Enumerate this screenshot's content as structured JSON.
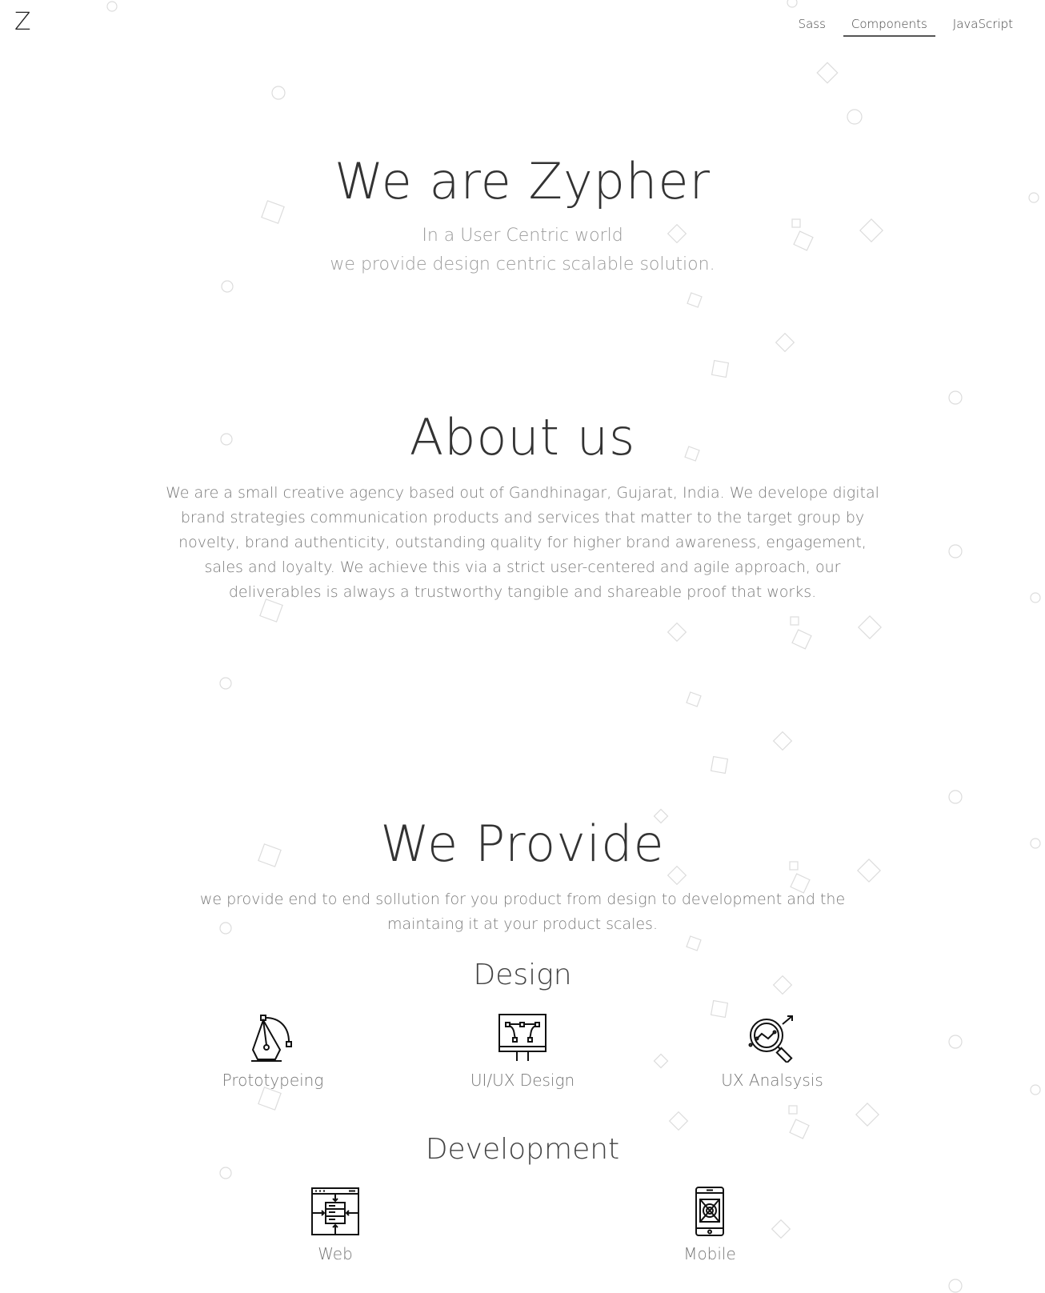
{
  "brand": {
    "logo": "Z"
  },
  "nav": {
    "items": [
      {
        "label": "Sass"
      },
      {
        "label": "Components",
        "active": true
      },
      {
        "label": "JavaScript"
      }
    ]
  },
  "hero": {
    "title": "We are Zypher",
    "subtitle_line1": "In a User Centric world",
    "subtitle_line2": "we provide design centric scalable solution."
  },
  "about": {
    "title": "About us",
    "text": "We are a small creative agency based out of Gandhinagar, Gujarat, India. We develope digital brand strategies communication products and services that matter to the target group by novelty, brand authenticity, outstanding quality for higher brand awareness, engagement, sales and loyalty. We achieve this via a strict user-centered and agile approach, our deliverables is always a trustworthy tangible and shareable proof that works."
  },
  "provide": {
    "title": "We Provide",
    "text": "we provide end to end sollution for you product from design to development and the maintaing it at your product scales.",
    "design": {
      "title": "Design",
      "items": [
        {
          "label": "Prototypeing",
          "icon": "pen-tool-icon"
        },
        {
          "label": "UI/UX Design",
          "icon": "design-board-icon"
        },
        {
          "label": "UX Analsysis",
          "icon": "magnifier-chart-icon"
        }
      ]
    },
    "development": {
      "title": "Development",
      "items": [
        {
          "label": "Web",
          "icon": "web-server-icon"
        },
        {
          "label": "Mobile",
          "icon": "mobile-phone-icon"
        }
      ]
    }
  }
}
